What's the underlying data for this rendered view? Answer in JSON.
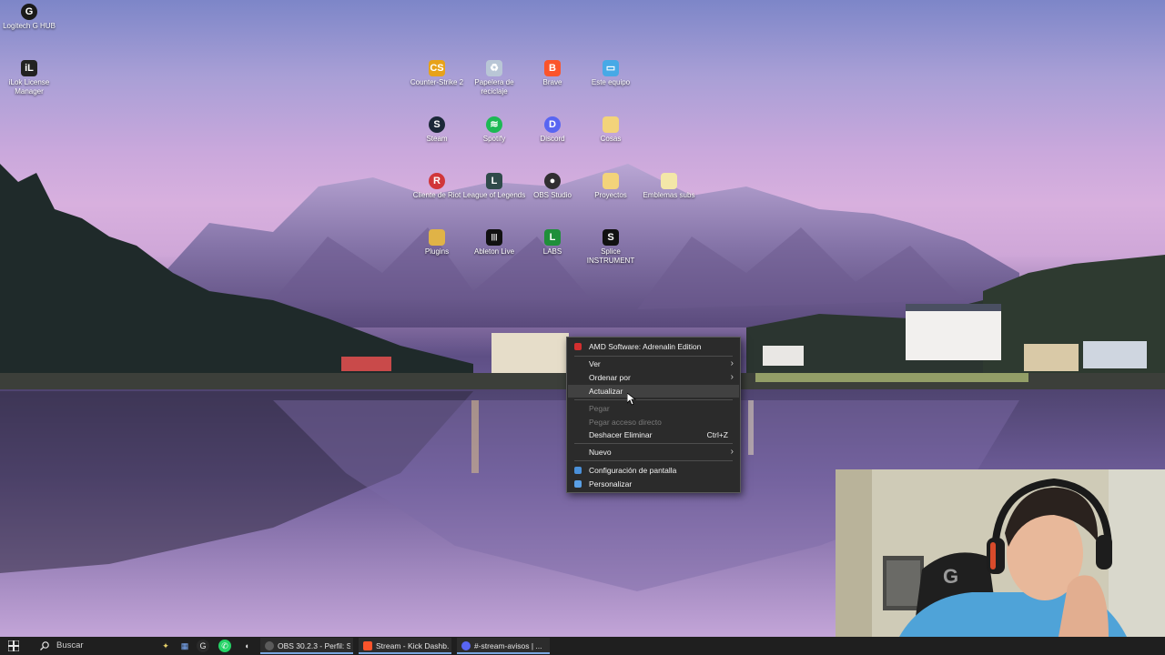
{
  "desktop": {
    "icons": [
      {
        "label": "Logitech G HUB",
        "icon": "logitech-icon",
        "color": "#1a1a1a",
        "glyph": "G"
      },
      {
        "label": "iLok License Manager",
        "icon": "ilok-icon",
        "color": "#222222",
        "glyph": "iL"
      },
      {
        "label": "Counter-Strike 2",
        "icon": "counter-strike-icon",
        "color": "#e7a21a",
        "glyph": "CS"
      },
      {
        "label": "Papelera de reciclaje",
        "icon": "recycle-bin-icon",
        "color": "#b9c6d6",
        "glyph": "♻"
      },
      {
        "label": "Brave",
        "icon": "brave-icon",
        "color": "#fb542b",
        "glyph": "B"
      },
      {
        "label": "Este equipo",
        "icon": "this-pc-icon",
        "color": "#47a9e6",
        "glyph": "▭"
      },
      {
        "label": "Steam",
        "icon": "steam-icon",
        "color": "#1b2838",
        "glyph": "S"
      },
      {
        "label": "Spotify",
        "icon": "spotify-icon",
        "color": "#1db954",
        "glyph": "≋"
      },
      {
        "label": "Discord",
        "icon": "discord-icon",
        "color": "#5865f2",
        "glyph": "D"
      },
      {
        "label": "Cosas",
        "icon": "folder-icon",
        "color": "#f3d37a",
        "glyph": ""
      },
      {
        "label": "Cliente de Riot",
        "icon": "riot-client-icon",
        "color": "#d13639",
        "glyph": "R"
      },
      {
        "label": "League of Legends",
        "icon": "league-of-legends-icon",
        "color": "#2f4a4a",
        "glyph": "L"
      },
      {
        "label": "OBS Studio",
        "icon": "obs-icon",
        "color": "#302e31",
        "glyph": "●"
      },
      {
        "label": "Proyectos",
        "icon": "folder-icon",
        "color": "#f3d37a",
        "glyph": ""
      },
      {
        "label": "Emblemas subs",
        "icon": "folder-icon",
        "color": "#f3e7a8",
        "glyph": ""
      },
      {
        "label": "Plugins",
        "icon": "plugins-folder-icon",
        "color": "#e0b347",
        "glyph": ""
      },
      {
        "label": "Ableton Live",
        "icon": "ableton-icon",
        "color": "#111111",
        "glyph": "|||"
      },
      {
        "label": "LABS",
        "icon": "labs-icon",
        "color": "#1f8f3a",
        "glyph": "L"
      },
      {
        "label": "Splice INSTRUMENT",
        "icon": "splice-icon",
        "color": "#111111",
        "glyph": "S"
      }
    ]
  },
  "context_menu": {
    "header": "AMD Software: Adrenalin Edition",
    "items": [
      {
        "label": "Ver",
        "submenu": true
      },
      {
        "label": "Ordenar por",
        "submenu": true
      },
      {
        "label": "Actualizar"
      },
      {
        "label": "Pegar",
        "disabled": true
      },
      {
        "label": "Pegar acceso directo",
        "disabled": true
      },
      {
        "label": "Deshacer Eliminar",
        "shortcut": "Ctrl+Z"
      },
      {
        "label": "Nuevo",
        "submenu": true
      },
      {
        "label": "Configuración de pantalla"
      },
      {
        "label": "Personalizar"
      }
    ],
    "submenu_arrow": "›"
  },
  "taskbar": {
    "search_placeholder": "Buscar",
    "apps": [
      {
        "label": "OBS 30.2.3 - Perfil: Si...",
        "icon": "obs-icon",
        "color": "#5b5b5b"
      },
      {
        "label": "Stream - Kick Dashb...",
        "icon": "brave-icon",
        "color": "#fb542b"
      },
      {
        "label": "#-stream-avisos | ...",
        "icon": "discord-icon",
        "color": "#5865f2"
      }
    ]
  },
  "colors": {
    "menu_bg": "#2b2b2b",
    "taskbar_bg": "#1f1f1f",
    "accent": "#7aa7e0"
  }
}
